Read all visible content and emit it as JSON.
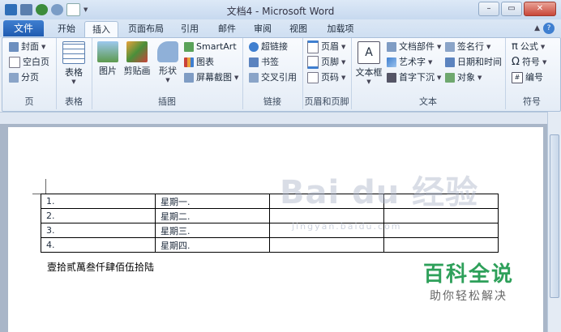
{
  "window": {
    "title": "文档4 - Microsoft Word",
    "btn_min": "–",
    "btn_max": "▭",
    "btn_close": "✕"
  },
  "tabs": {
    "file": "文件",
    "items": [
      "开始",
      "插入",
      "页面布局",
      "引用",
      "邮件",
      "审阅",
      "视图",
      "加载项"
    ],
    "active": "插入"
  },
  "ribbon": {
    "pages": {
      "label": "页",
      "items": [
        "封面",
        "空白页",
        "分页"
      ]
    },
    "table": {
      "label": "表格",
      "button": "表格"
    },
    "illustrations": {
      "label": "插图",
      "picture": "图片",
      "clipart": "剪贴画",
      "shapes": "形状",
      "smartart": "SmartArt",
      "chart": "图表",
      "screenshot": "屏幕截图"
    },
    "links": {
      "label": "链接",
      "hyperlink": "超链接",
      "bookmark": "书签",
      "crossref": "交叉引用"
    },
    "headerfooter": {
      "label": "页眉和页脚",
      "header": "页眉",
      "footer": "页脚",
      "pagenum": "页码"
    },
    "text": {
      "label": "文本",
      "textbox": "文本框",
      "quickparts": "文档部件",
      "wordart": "艺术字",
      "dropcap": "首字下沉",
      "sigline": "签名行",
      "datetime": "日期和时间",
      "object": "对象"
    },
    "symbols": {
      "label": "符号",
      "equation": "公式",
      "symbol": "符号",
      "number": "编号"
    }
  },
  "doc_table": [
    [
      "1.",
      "星期一."
    ],
    [
      "2.",
      "星期二."
    ],
    [
      "3.",
      "星期三."
    ],
    [
      "4.",
      "星期四."
    ]
  ],
  "doc_text": "壹拾贰萬叁仟肆佰伍拾陆",
  "watermark": {
    "main": "Bai du 经验",
    "sub": "jingyan.baidu.com"
  },
  "brand": {
    "line1": "百科全说",
    "line2": "助你轻松解决"
  },
  "colors": {
    "file_tab": "#2a66be",
    "brand_green": "#2ea05a"
  }
}
